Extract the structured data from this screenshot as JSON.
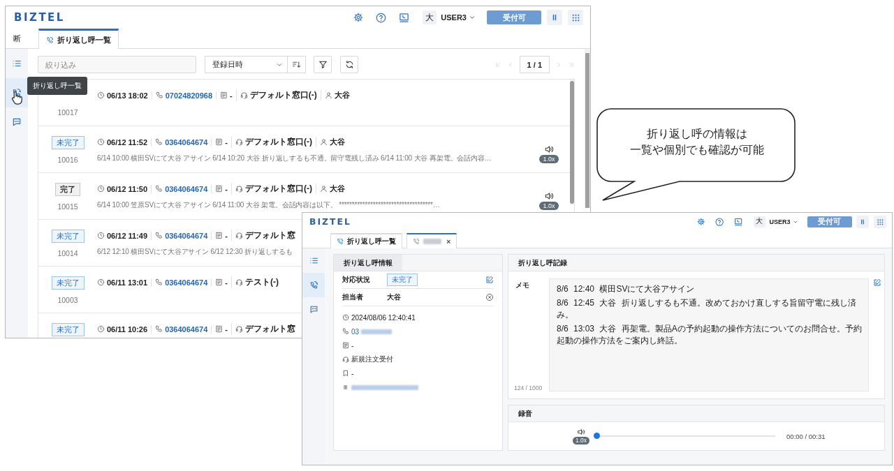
{
  "back_window": {
    "header": {
      "logo": "BIZTEL",
      "user_initial": "大",
      "user_name": "USER3",
      "status_button": "受付可"
    },
    "tab_bar": {
      "prefix": "断",
      "tabs": [
        {
          "label": "折り返し呼一覧",
          "selected": true
        }
      ]
    },
    "sidebar": [
      {
        "kind": "list",
        "selected": false
      },
      {
        "kind": "callback",
        "selected": true
      },
      {
        "kind": "chat",
        "selected": false
      }
    ],
    "tooltip": "折り返し呼一覧",
    "toolbar": {
      "filter_placeholder": "絞り込み",
      "sort_field": "登録日時",
      "page": "1 / 1"
    },
    "rows": [
      {
        "id": "10017",
        "datetime": "06/13 18:02",
        "phone": "07024820968",
        "category": "-",
        "queue": "デフォルト窓口(-)",
        "agent": "大谷"
      },
      {
        "status": {
          "label": "未完了",
          "done": false
        },
        "id": "10016",
        "datetime": "06/12 11:52",
        "phone": "0364064674",
        "category": "-",
        "queue": "デフォルト窓口(-)",
        "agent": "大谷",
        "memo": "6/14 10:00 横田SVにて大谷 アサイン 6/14 10:20 大谷 折り返しするも不通。留守電残し済み 6/14 11:00 大谷 再架電。会話内容…",
        "speed": "1.0x"
      },
      {
        "status": {
          "label": "完了",
          "done": true
        },
        "id": "10015",
        "datetime": "06/12 11:50",
        "phone": "0364064674",
        "category": "-",
        "queue": "デフォルト窓口(-)",
        "agent": "大谷",
        "memo": "6/14 10:00 笠原SVにて大谷 アサイン 6/14 11:00 大谷 架電。会話内容は以下。 ************************************…",
        "speed": "1.0x"
      },
      {
        "status": {
          "label": "未完了",
          "done": false
        },
        "id": "10014",
        "datetime": "06/12 11:49",
        "phone": "0364064674",
        "category": "-",
        "queue": "デフォルト窓",
        "memo": "6/12 12:10 横田SVにて大谷アサイン 6/12 12:30 折り返しするも"
      },
      {
        "status": {
          "label": "未完了",
          "done": false
        },
        "id": "10003",
        "datetime": "06/11 13:01",
        "phone": "0364064674",
        "category": "-",
        "queue": "テスト(-)"
      },
      {
        "status": {
          "label": "未完了",
          "done": false
        },
        "datetime": "06/11 10:26",
        "phone": "0364064674",
        "category": "-",
        "queue": "デフォルト窓"
      }
    ]
  },
  "callout": {
    "lines": [
      "折り返し呼の情報は",
      "一覧や個別でも確認が可能"
    ]
  },
  "front_window": {
    "header": {
      "logo": "BIZTEL",
      "user_initial": "大",
      "user_name": "USER3",
      "status_button": "受付可"
    },
    "tabs": [
      {
        "label": "折り返し呼一覧",
        "selected": false
      },
      {
        "selected": true,
        "close": "×"
      }
    ],
    "sidebar": [
      {
        "kind": "list",
        "selected": false
      },
      {
        "kind": "callback",
        "selected": true
      },
      {
        "kind": "chat",
        "selected": false
      }
    ],
    "info_panel": {
      "title": "折り返し呼情報",
      "fields": [
        {
          "label": "対応状況",
          "kind": "status",
          "value": "未完了"
        },
        {
          "label": "担当者",
          "kind": "assignee",
          "value": "大谷"
        }
      ],
      "details": [
        {
          "kind": "time",
          "text": "2024/08/06 12:40:41"
        },
        {
          "kind": "phone",
          "text": "03",
          "blurred": true
        },
        {
          "kind": "category",
          "text": "-"
        },
        {
          "kind": "queue",
          "text": "新規注文受付"
        },
        {
          "kind": "tag",
          "text": "-"
        },
        {
          "kind": "id",
          "blurred": true
        }
      ]
    },
    "record_panel": {
      "title": "折り返し呼記録",
      "memo_label": "メモ",
      "memo_lines": [
        "8/6 12:40 横田SVにて大谷アサイン",
        "8/6 12:45 大谷 折り返しするも不通。改めておかけ直しする旨留守電に残し済み。",
        "8/6 13:03 大谷 再架電。製品Aの予約起動の操作方法についてのお問合せ。予約起動の操作方法をご案内し終話。"
      ],
      "counter": "124 / 1000"
    },
    "recording": {
      "title": "録音",
      "speed": "1.0x",
      "level": 0,
      "time": "00:00 / 00:31"
    }
  }
}
